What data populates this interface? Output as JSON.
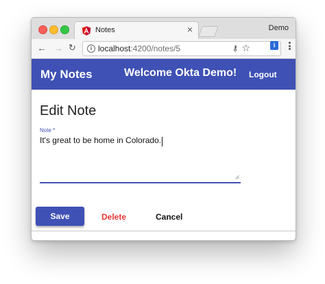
{
  "browser": {
    "tab_title": "Notes",
    "tab_close": "×",
    "profile_name": "Demo",
    "url_host": "localhost",
    "url_path": ":4200/notes/5",
    "icons": {
      "tab_favicon": "angular-icon",
      "back": "back-arrow-icon",
      "forward": "forward-arrow-icon",
      "reload": "reload-icon",
      "info": "info-icon",
      "key": "key-icon",
      "star": "star-icon",
      "extension": "extension-icon",
      "menu": "kebab-menu-icon"
    }
  },
  "app": {
    "title": "My Notes",
    "welcome": "Welcome Okta Demo!",
    "logout": "Logout",
    "accent_color": "#3f51b5",
    "danger_color": "#e53935"
  },
  "form": {
    "heading": "Edit Note",
    "note_label": "Note",
    "required_mark": "*",
    "note_value": "It's great to be home in Colorado."
  },
  "actions": {
    "save": "Save",
    "delete": "Delete",
    "cancel": "Cancel"
  }
}
